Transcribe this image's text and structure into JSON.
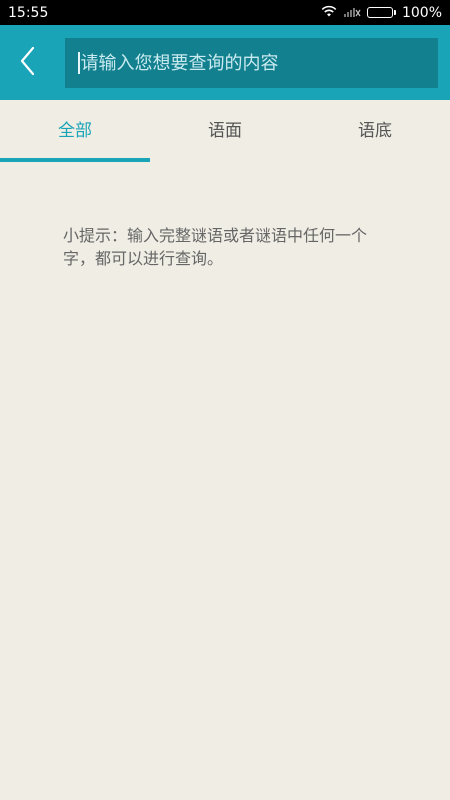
{
  "status_bar": {
    "time": "15:55",
    "battery_text": "100%",
    "battery_level": 1.0
  },
  "search": {
    "placeholder": "请输入您想要查询的内容",
    "value": ""
  },
  "tabs": [
    {
      "label": "全部",
      "active": true
    },
    {
      "label": "语面",
      "active": false
    },
    {
      "label": "语底",
      "active": false
    }
  ],
  "hint": {
    "text": "小提示：输入完整谜语或者谜语中任何一个字，都可以进行查询。"
  },
  "colors": {
    "accent": "#1aa4b8",
    "search_bg": "#13808f",
    "background": "#efede4"
  }
}
